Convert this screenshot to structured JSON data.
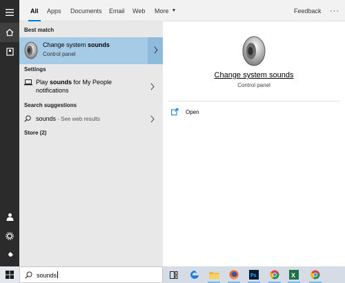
{
  "topbar": {
    "tabs": [
      {
        "label": "All"
      },
      {
        "label": "Apps"
      },
      {
        "label": "Documents"
      },
      {
        "label": "Email"
      },
      {
        "label": "Web"
      },
      {
        "label": "More"
      }
    ],
    "feedback_label": "Feedback",
    "overflow_label": "···"
  },
  "rail": {
    "icons": [
      "hamburger-icon",
      "home-icon",
      "notebook-icon",
      "person-icon",
      "gear-icon",
      "feedback-hub-icon"
    ]
  },
  "results": {
    "best_match_header": "Best match",
    "best_match": {
      "title_prefix": "Change system ",
      "title_bold": "sounds",
      "subtitle": "Control panel"
    },
    "settings_header": "Settings",
    "settings_item": {
      "prefix": "Play ",
      "bold": "sounds",
      "suffix": " for My People",
      "line2": "notifications"
    },
    "suggestions_header": "Search suggestions",
    "suggestion": {
      "text": "sounds",
      "suffix": " - See web results"
    },
    "store_header": "Store (2)"
  },
  "preview": {
    "title": "Change system sounds",
    "subtitle": "Control panel",
    "open_label": "Open"
  },
  "taskbar": {
    "search_value": "sounds",
    "apps": [
      "task-view-icon",
      "edge-icon",
      "file-explorer-icon",
      "firefox-icon",
      "photoshop-icon",
      "chrome-icon",
      "excel-icon",
      "chrome-icon"
    ]
  },
  "colors": {
    "accent": "#0078d7",
    "selection": "#a6cbe6",
    "rail": "#2b2b2b",
    "taskbar": "#d6dce5"
  }
}
